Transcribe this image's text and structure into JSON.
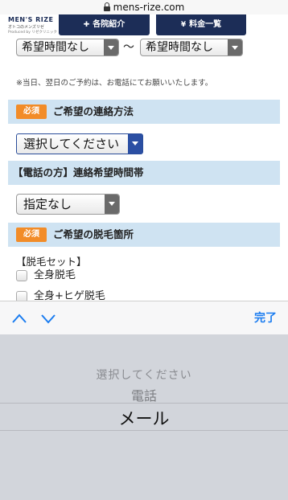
{
  "browser": {
    "url": "mens-rize.com"
  },
  "header": {
    "logo_line1": "MEN'S RIZE",
    "logo_line2": "オトコのメンズリゼ",
    "logo_line3": "Produced by リゼクリニック",
    "nav_clinic": "各院紹介",
    "nav_price": "料金一覧",
    "nav_price_icon": "¥"
  },
  "time_selects": {
    "from": "希望時間なし",
    "separator": "〜",
    "to": "希望時間なし"
  },
  "note": "※当日、翌日のご予約は、お電話にてお願いいたします。",
  "contact_section": {
    "badge": "必須",
    "title": "ご希望の連絡方法",
    "selected": "選択してください"
  },
  "time_section": {
    "title": "【電話の方】連絡希望時間帯",
    "selected": "指定なし"
  },
  "removal_section": {
    "badge": "必須",
    "title": "ご希望の脱毛箇所",
    "set_label": "【脱毛セット】",
    "options": [
      "全身脱毛",
      "全身+ヒゲ脱毛"
    ]
  },
  "picker": {
    "done_label": "完了",
    "options": [
      "選択してください",
      "電話",
      "メール"
    ],
    "selected": "メール"
  }
}
